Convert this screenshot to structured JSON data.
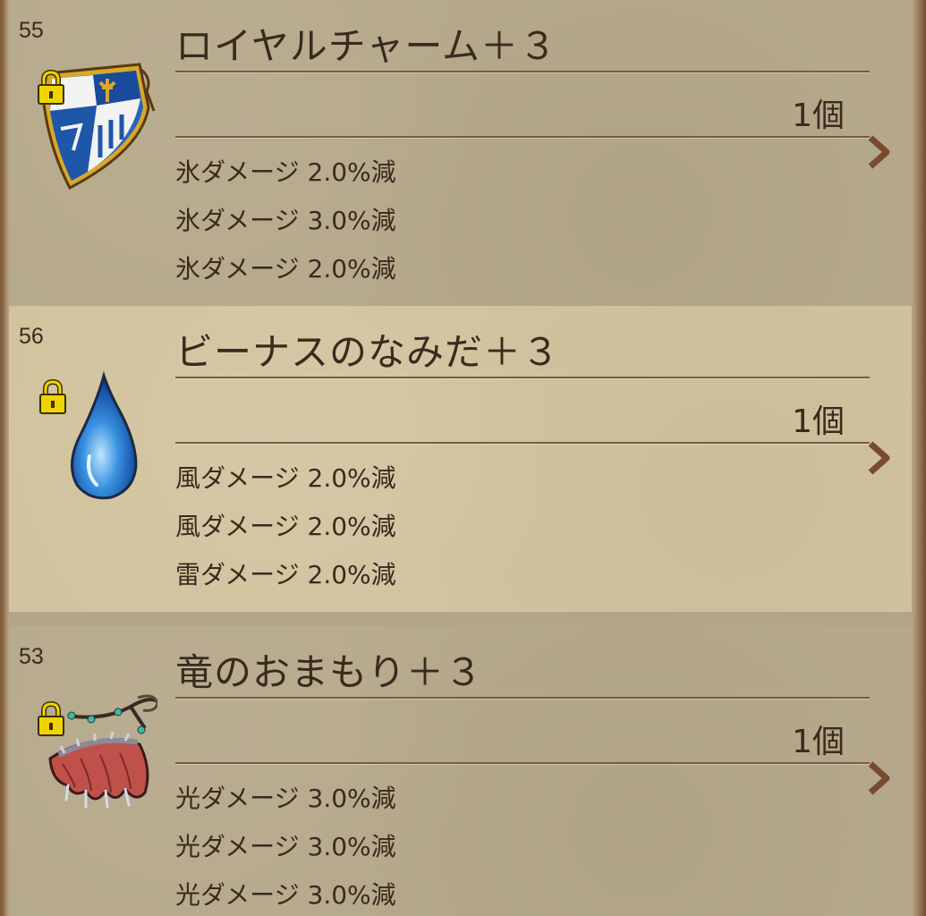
{
  "items": [
    {
      "level": "55",
      "name": "ロイヤルチャーム＋３",
      "count": "1個",
      "icon": "shield-icon",
      "effects": [
        "氷ダメージ 2.0%減",
        "氷ダメージ 3.0%減",
        "氷ダメージ 2.0%減"
      ]
    },
    {
      "level": "56",
      "name": "ビーナスのなみだ＋３",
      "count": "1個",
      "icon": "water-drop-icon",
      "effects": [
        "風ダメージ 2.0%減",
        "風ダメージ 2.0%減",
        "雷ダメージ 2.0%減"
      ]
    },
    {
      "level": "53",
      "name": "竜のおまもり＋３",
      "count": "1個",
      "icon": "dragon-wing-icon",
      "effects": [
        "光ダメージ 3.0%減",
        "光ダメージ 3.0%減",
        "光ダメージ 3.0%減"
      ]
    }
  ],
  "colors": {
    "text": "#3a2a1e",
    "row_dark": "#b6a98b",
    "row_light": "#d2c39e",
    "divider": "#7a5a42",
    "chevron": "#7a4a30",
    "lock": "#f0d400"
  }
}
